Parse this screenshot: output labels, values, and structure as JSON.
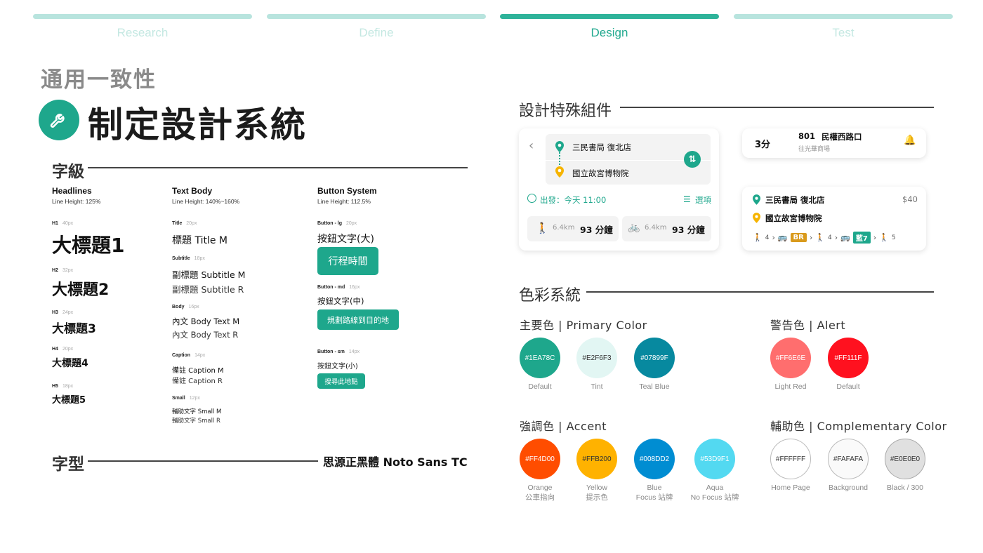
{
  "steps": [
    {
      "label": "Research",
      "active": false
    },
    {
      "label": "Define",
      "active": false
    },
    {
      "label": "Design",
      "active": true
    },
    {
      "label": "Test",
      "active": false
    }
  ],
  "header": {
    "subtitle": "通用一致性",
    "title": "制定設計系統",
    "icon": "wrench-icon"
  },
  "typography": {
    "section_title": "字級",
    "headlines": {
      "title": "Headlines",
      "line_height": "Line Height: 125%",
      "items": [
        {
          "tag": "H1",
          "size": "40px",
          "text": "大標題1"
        },
        {
          "tag": "H2",
          "size": "32px",
          "text": "大標題2"
        },
        {
          "tag": "H3",
          "size": "24px",
          "text": "大標題3"
        },
        {
          "tag": "H4",
          "size": "20px",
          "text": "大標題4"
        },
        {
          "tag": "H5",
          "size": "18px",
          "text": "大標題5"
        }
      ]
    },
    "text_body": {
      "title": "Text Body",
      "line_height": "Line Height: 140%~160%",
      "title_tag": "Title",
      "title_size": "20px",
      "title_text": "標題 Title M",
      "subtitle_tag": "Subtitle",
      "subtitle_size": "18px",
      "subtitle_m": "副標題 Subtitle M",
      "subtitle_r": "副標題 Subtitle R",
      "body_tag": "Body",
      "body_size": "16px",
      "body_m": "內文 Body Text M",
      "body_r": "內文 Body Text R",
      "caption_tag": "Caption",
      "caption_size": "14px",
      "caption_m": "備註 Caption M",
      "caption_r": "備註 Caption R",
      "small_tag": "Small",
      "small_size": "12px",
      "small_m": "輔助文字 Small M",
      "small_r": "輔助文字 Small R"
    },
    "button_system": {
      "title": "Button System",
      "line_height": "Line Height: 112.5%",
      "lg_tag": "Button - lg",
      "lg_size": "20px",
      "lg_text": "按鈕文字(大)",
      "lg_button": "行程時間",
      "md_tag": "Button - md",
      "md_size": "16px",
      "md_text": "按鈕文字(中)",
      "md_button": "規劃路線到目的地",
      "sm_tag": "Button - sm",
      "sm_size": "14px",
      "sm_text": "按鈕文字(小)",
      "sm_button": "搜尋此地點"
    },
    "font_section_title": "字型",
    "font_name": "思源正黑體 Noto Sans TC"
  },
  "components": {
    "section_title": "設計特殊組件",
    "route_card": {
      "origin": "三民書局 復北店",
      "destination": "國立故宮博物院",
      "depart": "出發：今天 11:00",
      "options": "選項",
      "walk_distance": "6.4km",
      "walk_time": "93 分鐘",
      "bike_distance": "6.4km",
      "bike_time": "93 分鐘"
    },
    "bus_card": {
      "minutes": "3分",
      "route": "801",
      "stop": "民權西路口",
      "direction": "往光華商場"
    },
    "trip_card": {
      "origin": "三民書局 復北店",
      "destination": "國立故宮博物院",
      "price": "$40",
      "walk1": "4",
      "badge_br": "BR",
      "walk2": "4",
      "badge_blue": "藍7",
      "walk3": "5"
    }
  },
  "colors": {
    "section_title": "色彩系統",
    "primary": {
      "title": "主要色 | Primary Color",
      "swatches": [
        {
          "hex": "#1EA78C",
          "label": "Default"
        },
        {
          "hex": "#E2F6F3",
          "label": "Tint"
        },
        {
          "hex": "#07899F",
          "label": "Teal Blue"
        }
      ]
    },
    "alert": {
      "title": "警告色 | Alert",
      "swatches": [
        {
          "hex": "#FF6E6E",
          "label": "Light Red"
        },
        {
          "hex": "#FF111F",
          "label": "Default"
        }
      ]
    },
    "accent": {
      "title": "強調色 | Accent",
      "swatches": [
        {
          "hex": "#FF4D00",
          "label": "Orange",
          "label2": "公車指向"
        },
        {
          "hex": "#FFB200",
          "label": "Yellow",
          "label2": "提示色"
        },
        {
          "hex": "#008DD2",
          "label": "Blue",
          "label2": "Focus 站牌"
        },
        {
          "hex": "#53D9F1",
          "label": "Aqua",
          "label2": "No Focus 站牌"
        }
      ]
    },
    "complementary": {
      "title": "輔助色 | Complementary Color",
      "swatches": [
        {
          "hex": "#FFFFFF",
          "label": "Home Page"
        },
        {
          "hex": "#FAFAFA",
          "label": "Background"
        },
        {
          "hex": "#E0E0E0",
          "label": "Black / 300"
        }
      ]
    }
  }
}
